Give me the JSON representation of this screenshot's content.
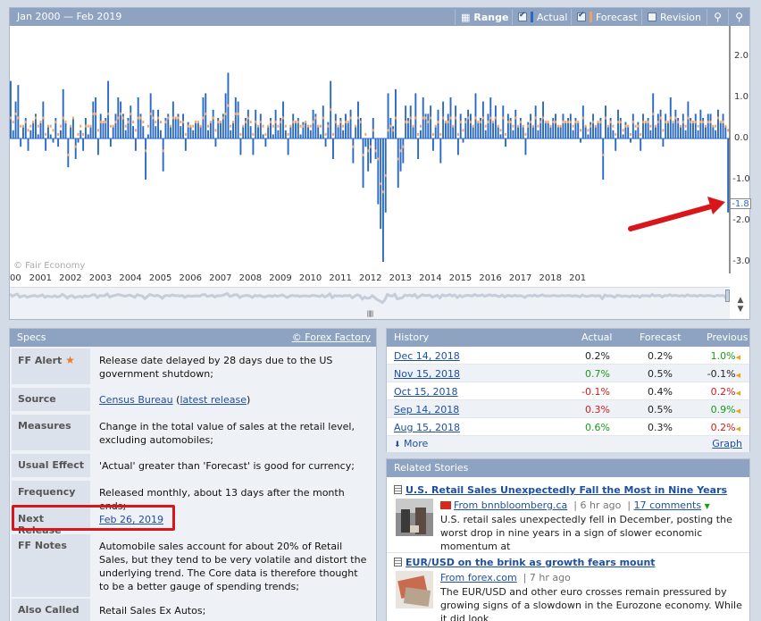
{
  "chart_toolbar": {
    "range_text": "Jan 2000 — Feb 2019",
    "range_label": "Range",
    "actual_label": "Actual",
    "forecast_label": "Forecast",
    "revision_label": "Revision",
    "actual_color": "#2a6ac2",
    "forecast_color": "#f0a060"
  },
  "chart_data": {
    "type": "bar",
    "x_range": [
      "Jan 2000",
      "Feb 2019"
    ],
    "x_tick_labels": [
      "00",
      "2001",
      "2002",
      "2003",
      "2004",
      "2005",
      "2006",
      "2007",
      "2008",
      "2009",
      "2010",
      "2011",
      "2012",
      "2013",
      "2014",
      "2015",
      "2016",
      "2017",
      "2018",
      "201"
    ],
    "y_tick_labels": [
      "2.0",
      "1.0",
      "0.0",
      "-1.0",
      "-2.0",
      "-3.0"
    ],
    "ylim": [
      -3.2,
      2.6
    ],
    "watermark": "© Fair Economy",
    "current_value": "-1.8",
    "grid": false,
    "series": [
      {
        "name": "Actual",
        "values": [
          1.4,
          0.2,
          0.9,
          1.3,
          -0.2,
          0.3,
          0.5,
          -0.3,
          0.2,
          0.4,
          0.6,
          0.1,
          0.4,
          0.9,
          -0.3,
          0.3,
          0.1,
          -0.1,
          0.5,
          -0.2,
          0.2,
          1.2,
          0.4,
          -0.7,
          0.3,
          0.5,
          -0.5,
          -0.1,
          0.2,
          -0.3,
          0.5,
          0.1,
          0.3,
          0.9,
          1.0,
          -0.4,
          0.6,
          0.4,
          0.5,
          1.4,
          -0.2,
          0.3,
          0.6,
          1.0,
          0.9,
          0.6,
          0.2,
          0.5,
          0.8,
          0.3,
          -0.3,
          1.0,
          0.6,
          0.3,
          -1.0,
          0.1,
          1.1,
          0.7,
          0.3,
          0.7,
          0.2,
          -0.8,
          0.5,
          0.6,
          0.3,
          0.9,
          0.5,
          0.6,
          0.3,
          0.6,
          -0.3,
          0.4,
          0.3,
          0.2,
          0.4,
          0.4,
          0.3,
          1.0,
          1.1,
          0.2,
          0.4,
          0.7,
          -0.2,
          0.5,
          0.4,
          0.6,
          1.1,
          1.6,
          0.2,
          0.4,
          1.0,
          0.9,
          -0.4,
          0.3,
          0.5,
          0.7,
          0.3,
          -0.4,
          0.7,
          0.3,
          0.6,
          0.1,
          -0.2,
          0.3,
          0.5,
          0.1,
          0.7,
          0.2,
          0.5,
          0.9,
          0.2,
          -0.4,
          0.3,
          0.6,
          0.4,
          0.5,
          0.1,
          0.4,
          0.4,
          0.3,
          0.2,
          0.7,
          0.6,
          0.3,
          0.1,
          0.8,
          -0.2,
          0.4,
          1.4,
          -0.5,
          0.6,
          0.3,
          0.5,
          0.2,
          0.6,
          0.4,
          0.7,
          -0.6,
          0.3,
          0.9,
          0.5,
          -1.2,
          -0.2,
          -0.8,
          -0.6,
          0.5,
          -0.5,
          -1.6,
          -2.2,
          -3.0,
          -1.8,
          1.1,
          0.5,
          0.3,
          1.2,
          -1.2,
          -0.8,
          -0.6,
          0.8,
          0.5,
          0.8,
          0.3,
          1.1,
          -0.5,
          0.2,
          1.0,
          0.6,
          0.6,
          0.8,
          -0.3,
          0.3,
          0.7,
          -0.6,
          0.9,
          0.4,
          0.6,
          1.0,
          0.3,
          0.8,
          -0.4,
          0.6,
          -0.1,
          0.5,
          0.7,
          0.6,
          0.3,
          1.1,
          0.4,
          0.5,
          0.9,
          0.2,
          0.6,
          1.0,
          0.4,
          0.8,
          0.3,
          0.1,
          0.8,
          -0.2,
          0.6,
          0.5,
          0.2,
          0.7,
          0.3,
          0.5,
          0.3,
          -0.4,
          0.4,
          0.6,
          0.3,
          0.8,
          0.2,
          0.5,
          0.9,
          0.4,
          0.4,
          0.3,
          0.5,
          0.6,
          0.3,
          0.3,
          0.6,
          0.4,
          0.5,
          0.6,
          0.2,
          0.5,
          0.4,
          -0.1,
          0.8,
          0.3,
          0.1,
          0.4,
          0.6,
          0.3,
          0.4,
          0.5,
          -1.0,
          0.8,
          0.3,
          0.5,
          0.2,
          -0.3,
          0.7,
          0.5,
          0.1,
          0.4,
          0.3,
          -0.1,
          0.6,
          0.2,
          0.4,
          -0.3,
          0.6,
          0.4,
          0.5,
          0.2,
          1.1,
          0.3,
          0.6,
          0.7,
          -0.2,
          0.6,
          0.4,
          1.0,
          0.4,
          0.7,
          0.5,
          0.3,
          0.6,
          0.2,
          0.9,
          0.5,
          0.4,
          0.6,
          0.2,
          0.7,
          0.5,
          0.3,
          0.6,
          0.6,
          0.3,
          0.2,
          0.7,
          0.4,
          0.6,
          0.3,
          -1.8
        ]
      },
      {
        "name": "Forecast",
        "values": [
          0.5,
          0.4,
          0.6,
          0.5,
          0.3,
          0.3,
          0.4,
          0.2,
          0.3,
          0.4,
          0.5,
          0.3,
          0.4,
          0.5,
          0.1,
          0.3,
          0.3,
          0.2,
          0.4,
          0.1,
          0.3,
          0.5,
          0.4,
          -0.4,
          0.3,
          0.5,
          -0.2,
          0.1,
          0.3,
          0.1,
          0.3,
          0.3,
          0.3,
          0.6,
          0.6,
          0.2,
          0.4,
          0.4,
          0.4,
          0.6,
          0.3,
          0.3,
          0.4,
          0.5,
          0.6,
          0.5,
          0.3,
          0.4,
          0.6,
          0.4,
          0.2,
          0.5,
          0.5,
          0.4,
          -0.3,
          0.3,
          0.6,
          0.5,
          0.4,
          0.5,
          0.4,
          -0.3,
          0.4,
          0.5,
          0.3,
          0.5,
          0.5,
          0.5,
          0.4,
          0.4,
          0.1,
          0.3,
          0.3,
          0.3,
          0.4,
          0.4,
          0.3,
          0.5,
          0.6,
          0.3,
          0.4,
          0.5,
          0.2,
          0.4,
          0.4,
          0.5,
          0.6,
          0.8,
          0.3,
          0.4,
          0.6,
          0.6,
          0.1,
          0.3,
          0.4,
          0.5,
          0.4,
          0.1,
          0.4,
          0.3,
          0.4,
          0.3,
          0.1,
          0.3,
          0.4,
          0.3,
          0.4,
          0.3,
          0.4,
          0.5,
          0.3,
          0.1,
          0.3,
          0.4,
          0.4,
          0.4,
          0.3,
          0.3,
          0.4,
          0.3,
          0.3,
          0.4,
          0.5,
          0.3,
          0.3,
          0.5,
          0.1,
          0.3,
          0.7,
          0.1,
          0.4,
          0.3,
          0.4,
          0.3,
          0.4,
          0.4,
          0.5,
          -0.2,
          0.3,
          0.5,
          0.4,
          -0.4,
          0.1,
          -0.3,
          -0.2,
          0.2,
          -0.3,
          -0.5,
          -1.1,
          -1.3,
          -0.9,
          0.2,
          0.3,
          0.2,
          0.5,
          -0.5,
          -0.3,
          -0.2,
          0.4,
          0.4,
          0.5,
          0.3,
          0.5,
          0.1,
          0.3,
          0.5,
          0.5,
          0.4,
          0.5,
          0.1,
          0.3,
          0.4,
          0.1,
          0.5,
          0.4,
          0.4,
          0.5,
          0.3,
          0.5,
          0.1,
          0.4,
          0.2,
          0.4,
          0.5,
          0.4,
          0.3,
          0.5,
          0.4,
          0.4,
          0.5,
          0.3,
          0.4,
          0.5,
          0.4,
          0.5,
          0.3,
          0.2,
          0.5,
          0.1,
          0.4,
          0.4,
          0.3,
          0.5,
          0.3,
          0.4,
          0.3,
          0.1,
          0.3,
          0.4,
          0.3,
          0.5,
          0.3,
          0.4,
          0.5,
          0.4,
          0.4,
          0.3,
          0.4,
          0.4,
          0.3,
          0.3,
          0.4,
          0.4,
          0.4,
          0.4,
          0.3,
          0.4,
          0.4,
          0.2,
          0.5,
          0.3,
          0.2,
          0.3,
          0.4,
          0.3,
          0.4,
          0.4,
          -0.4,
          0.5,
          0.3,
          0.4,
          0.3,
          0.1,
          0.4,
          0.4,
          0.2,
          0.3,
          0.3,
          0.1,
          0.4,
          0.3,
          0.3,
          0.1,
          0.4,
          0.4,
          0.4,
          0.3,
          0.6,
          0.3,
          0.4,
          0.5,
          0.2,
          0.4,
          0.4,
          0.5,
          0.4,
          0.5,
          0.4,
          0.3,
          0.4,
          0.3,
          0.5,
          0.4,
          0.4,
          0.4,
          0.3,
          0.4,
          0.4,
          0.3,
          0.4,
          0.4,
          0.3,
          0.3,
          0.5,
          0.4,
          0.4,
          0.3,
          0.2
        ]
      }
    ]
  },
  "specs": {
    "header": "Specs",
    "source_link": "© Forex Factory",
    "ff_alert": {
      "label": "FF Alert",
      "value": "Release date delayed by 28 days due to the US government shutdown;"
    },
    "source": {
      "label": "Source",
      "link": "Census Bureau",
      "open_paren": "(",
      "sub_link": "latest release",
      "close_paren": ")"
    },
    "measures": {
      "label": "Measures",
      "value": "Change in the total value of sales at the retail level, excluding automobiles;"
    },
    "usual_effect": {
      "label": "Usual Effect",
      "value": "'Actual' greater than 'Forecast' is good for currency;"
    },
    "frequency": {
      "label": "Frequency",
      "value": "Released monthly, about 13 days after the month ends;"
    },
    "next_release": {
      "label": "Next Release",
      "value": "Feb 26, 2019"
    },
    "ff_notes": {
      "label": "FF Notes",
      "value": "Automobile sales account for about 20% of Retail Sales, but they tend to be very volatile and distort the underlying trend. The Core data is therefore thought to be a better gauge of spending trends;"
    },
    "also_called": {
      "label": "Also Called",
      "value": "Retail Sales Ex Autos;"
    }
  },
  "history": {
    "header": "History",
    "col_actual": "Actual",
    "col_forecast": "Forecast",
    "col_previous": "Previous",
    "rows": [
      {
        "date": "Dec 14, 2018",
        "actual": "0.2%",
        "forecast": "0.2%",
        "previous": "1.0%",
        "actual_color": "#222222",
        "previous_color": "#1a9a1a"
      },
      {
        "date": "Nov 15, 2018",
        "actual": "0.7%",
        "forecast": "0.5%",
        "previous": "-0.1%",
        "actual_color": "#1a9a1a",
        "previous_color": "#222222"
      },
      {
        "date": "Oct 15, 2018",
        "actual": "-0.1%",
        "forecast": "0.4%",
        "previous": "0.2%",
        "actual_color": "#d01c1c",
        "previous_color": "#d01c1c"
      },
      {
        "date": "Sep 14, 2018",
        "actual": "0.3%",
        "forecast": "0.5%",
        "previous": "0.9%",
        "actual_color": "#d01c1c",
        "previous_color": "#1a9a1a"
      },
      {
        "date": "Aug 15, 2018",
        "actual": "0.6%",
        "forecast": "0.3%",
        "previous": "0.2%",
        "actual_color": "#1a9a1a",
        "previous_color": "#d01c1c"
      }
    ],
    "more_label": "More",
    "graph_label": "Graph"
  },
  "stories": {
    "header": "Related Stories",
    "items": [
      {
        "title": "U.S. Retail Sales Unexpectedly Fall the Most in Nine Years",
        "source": "From bnnbloomberg.ca",
        "age": "6 hr ago",
        "comments": "17 comments",
        "text": "U.S. retail sales unexpectedly fell in December, posting the worst drop in nine years in a sign of slower economic momentum at"
      },
      {
        "title": "EUR/USD on the brink as growth fears mount",
        "source": "From forex.com",
        "age": "7 hr ago",
        "text": "The EUR/USD and other euro crosses remain pressured by growing signs of a slowdown in the Eurozone economy. While it did look"
      }
    ]
  }
}
